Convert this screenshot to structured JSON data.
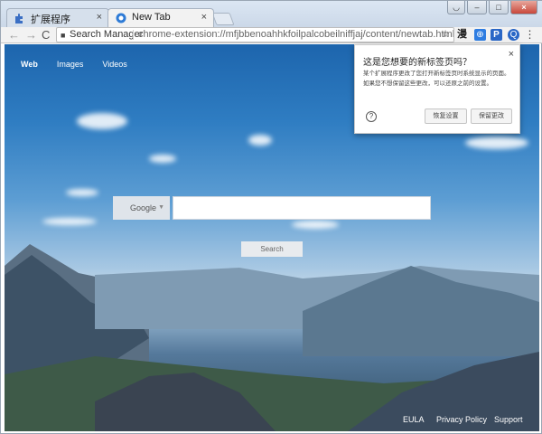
{
  "tabs": [
    {
      "title": "扩展程序",
      "icon": "puzzle-icon",
      "close": "×"
    },
    {
      "title": "New Tab",
      "icon": "globe-icon",
      "close": "×"
    }
  ],
  "window_controls": {
    "user": "◡",
    "minimize": "–",
    "maximize": "□",
    "close": "×"
  },
  "toolbar": {
    "back": "←",
    "forward": "→",
    "reload": "C",
    "omnibox": {
      "site_label": "Search Manager",
      "url": "chrome-extension://mfjbbenoahhkfoilpalcobeilniffjaj/content/newtab.html",
      "star": "☆"
    },
    "extensions": [
      "漫",
      "⊕",
      "P",
      "Q",
      "⋮"
    ]
  },
  "page": {
    "nav": [
      "Web",
      "Images",
      "Videos"
    ],
    "search": {
      "engine": "Google",
      "caret": "▼",
      "button": "Search"
    },
    "footer": [
      "EULA",
      "Privacy Policy",
      "Support"
    ]
  },
  "popup": {
    "title": "这是您想要的新标签页吗？",
    "body": "某个扩展程序更改了您打开新标签页时系统显示的页面。如果您不想保留这些更改，可以还原之前的设置。",
    "help": "?",
    "keep_button": "恢复设置",
    "restore_button": "保留更改",
    "close": "×"
  },
  "colors": {
    "sky_top": "#1d65ad",
    "sky_horizon": "#c9dbe9",
    "mountain": "#2f4b60"
  }
}
